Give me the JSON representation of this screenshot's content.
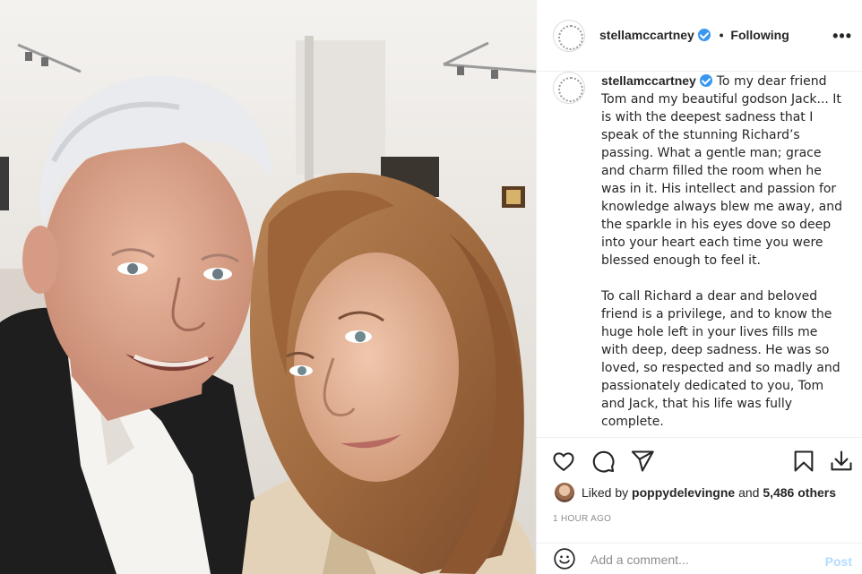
{
  "post": {
    "username": "stellamccartney",
    "follow_status": "Following",
    "separator": "•",
    "more_glyph": "•••",
    "caption_paragraphs": [
      "To my dear friend Tom and my beautiful godson Jack... It is with the deepest sadness that I speak of the stunning Richard’s passing. What a gentle man; grace and charm filled the room when he was in it. His intellect and passion for knowledge always blew me away, and the sparkle in his eyes dove so deep into your heart each time you were blessed enough to feel it.",
      "To call Richard a dear and beloved friend is a privilege, and to know the huge hole left in your lives fills me with deep, deep sadness. He was so loved, so respected and so madly and passionately dedicated to you, Tom and Jack, that his life was fully complete."
    ],
    "likes": {
      "prefix": "Liked by",
      "liker": "poppydelevingne",
      "middle": "and",
      "others": "5,486 others"
    },
    "timestamp": "1 HOUR AGO",
    "comment": {
      "placeholder": "Add a comment...",
      "post_label": "Post"
    }
  },
  "icons": {
    "like": "heart-icon",
    "comment": "comment-icon",
    "share": "paper-plane-icon",
    "save": "bookmark-icon",
    "download": "download-icon",
    "emoji": "emoji-icon",
    "verified": "verified-badge-icon"
  },
  "colors": {
    "verified_blue": "#3897f0",
    "muted_text": "#8e8e8e",
    "post_disabled": "#b3dbff",
    "border": "#efefef"
  }
}
